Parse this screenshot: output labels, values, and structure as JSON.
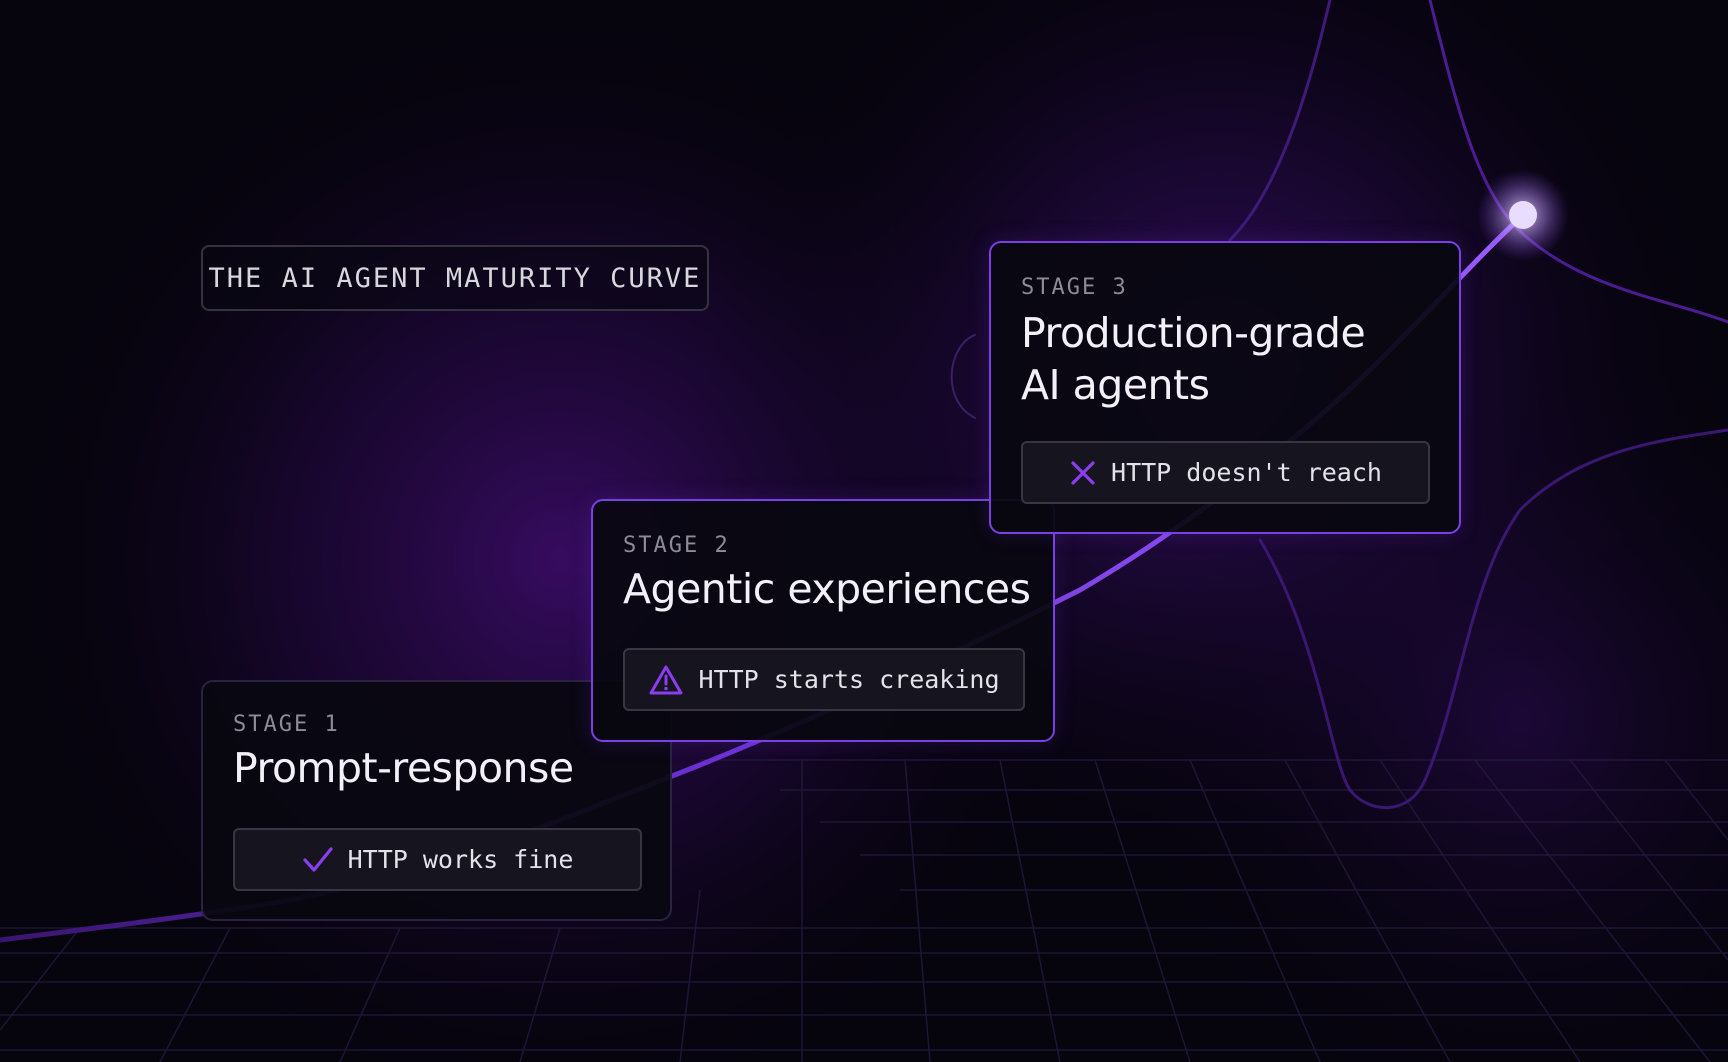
{
  "title": "THE AI AGENT MATURITY CURVE",
  "colors": {
    "background": "#06040d",
    "accent": "#7b3fe6",
    "accent_bright": "#9b5cff",
    "card_border": "#2b2140",
    "text": "#f3f1f7",
    "muted": "#8e8a99"
  },
  "stages": [
    {
      "label": "STAGE 1",
      "title_lines": [
        "Prompt-response"
      ],
      "status": "HTTP works fine",
      "status_icon": "check-icon",
      "active": false
    },
    {
      "label": "STAGE 2",
      "title_lines": [
        "Agentic experiences"
      ],
      "status": "HTTP starts creaking",
      "status_icon": "warning-triangle-icon",
      "active": true
    },
    {
      "label": "STAGE 3",
      "title_lines": [
        "Production-grade",
        "AI agents"
      ],
      "status": "HTTP doesn't reach",
      "status_icon": "x-icon",
      "active": true
    }
  ]
}
